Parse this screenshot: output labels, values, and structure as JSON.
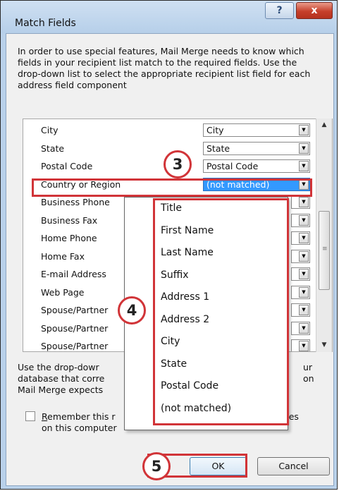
{
  "window": {
    "title": "Match Fields",
    "help_glyph": "?",
    "close_glyph": "x"
  },
  "intro_text": "In order to use special features, Mail Merge needs to know which fields in your recipient list match to the required fields.  Use the drop-down list to select the appropriate recipient list field for each address field component",
  "field_rows": [
    {
      "label": "City",
      "value": "City"
    },
    {
      "label": "State",
      "value": "State"
    },
    {
      "label": "Postal Code",
      "value": "Postal Code"
    },
    {
      "label": "Country or Region",
      "value": "(not matched)",
      "selected": true
    },
    {
      "label": "Business Phone",
      "value": ""
    },
    {
      "label": "Business Fax",
      "value": ""
    },
    {
      "label": "Home Phone",
      "value": ""
    },
    {
      "label": "Home Fax",
      "value": ""
    },
    {
      "label": "E-mail Address",
      "value": ""
    },
    {
      "label": "Web Page",
      "value": ""
    },
    {
      "label": "Spouse/Partner",
      "value": ""
    },
    {
      "label": "Spouse/Partner",
      "value": ""
    },
    {
      "label": "Spouse/Partner",
      "value": ""
    }
  ],
  "dropdown_options": [
    "Title",
    "First Name",
    "Last Name",
    "Suffix",
    "Address 1",
    "Address 2",
    "City",
    "State",
    "Postal Code",
    "(not matched)"
  ],
  "bottom_text": {
    "line1_left": "Use the drop-dowr",
    "line1_right": "ur",
    "line2_left": "database that corre",
    "line2_right": "on",
    "line3_left": "Mail Merge expects"
  },
  "remember": {
    "label_underlined": "R",
    "label_rest": "emember this r",
    "label_end": "rces",
    "line2": "on this computer",
    "checked": false
  },
  "buttons": {
    "ok": "OK",
    "cancel": "Cancel"
  },
  "annotations": {
    "step3": "3",
    "step4": "4",
    "step5": "5",
    "color": "#d13438"
  },
  "colors": {
    "selection": "#3399ff",
    "titlebar": "#b9d1ea",
    "close_button": "#c6402b"
  },
  "icons": {
    "scroll_up": "scroll-up-arrow-icon",
    "scroll_down": "scroll-down-arrow-icon",
    "combo_arrow": "chevron-down-icon"
  }
}
